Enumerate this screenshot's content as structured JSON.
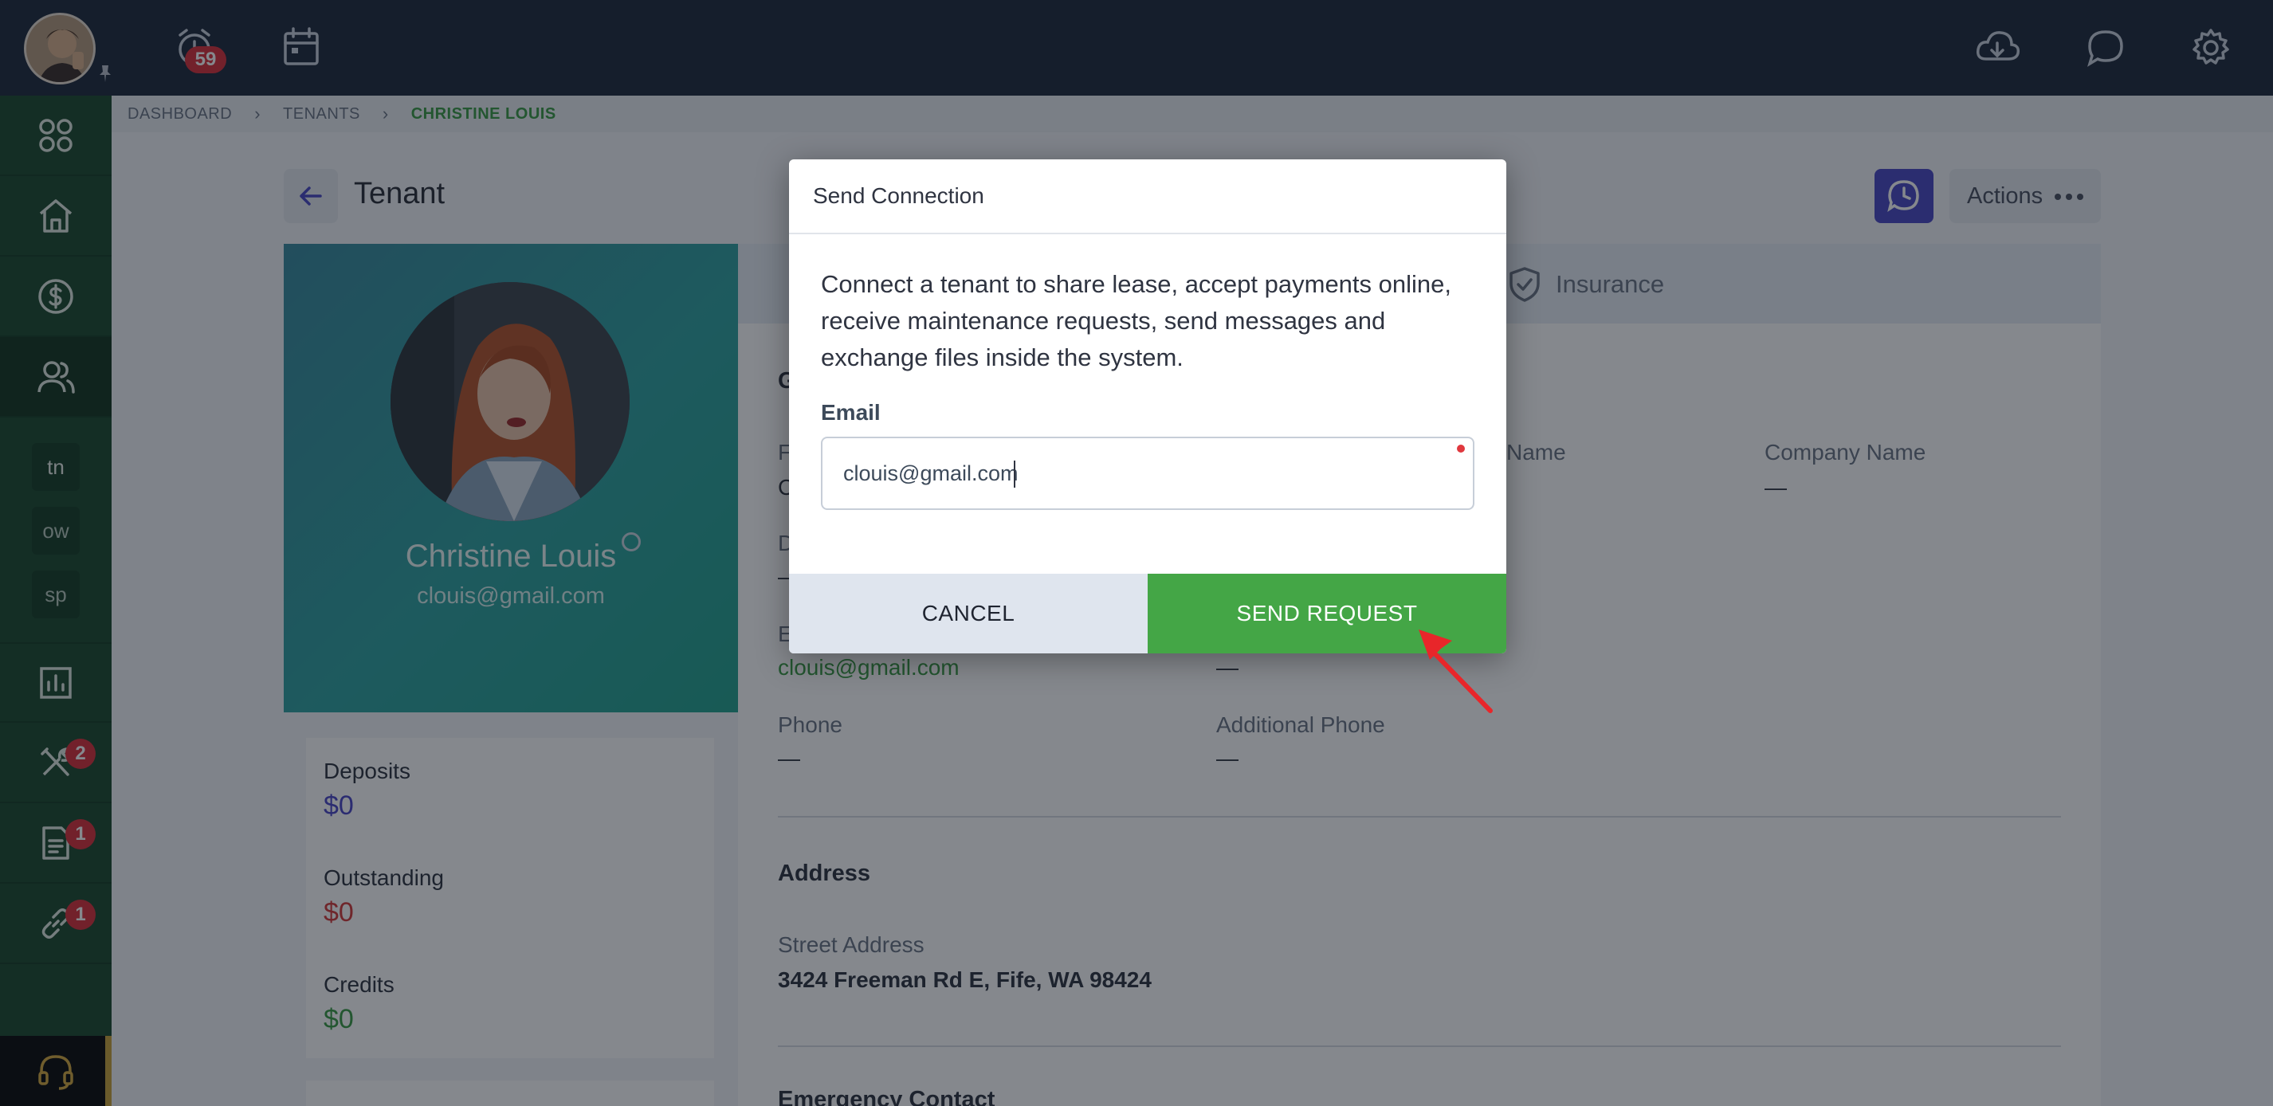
{
  "topbar": {
    "alarm_count": "59",
    "icons": [
      "alarm-clock-icon",
      "calendar-icon",
      "cloud-download-icon",
      "chat-bubble-icon",
      "gear-icon"
    ]
  },
  "sidebar": {
    "shortcuts": [
      "tn",
      "ow",
      "sp"
    ],
    "maintenance_badge": "2",
    "documents_badge": "1",
    "connections_badge": "1"
  },
  "breadcrumb": {
    "items": [
      "DASHBOARD",
      "TENANTS",
      "CHRISTINE LOUIS"
    ]
  },
  "page": {
    "title": "Tenant",
    "actions_label": "Actions"
  },
  "profile": {
    "name": "Christine Louis",
    "email": "clouis@gmail.com"
  },
  "balances": {
    "deposits_label": "Deposits",
    "deposits_value": "$0",
    "outstanding_label": "Outstanding",
    "outstanding_value": "$0",
    "credits_label": "Credits",
    "credits_value": "$0"
  },
  "details": {
    "insurance_tab": "Insurance",
    "partial_heading": "G",
    "partial_label_1": "F",
    "partial_value_1": "C",
    "partial_label_2": "D",
    "partial_value_2": "—",
    "partial_label_3": "E",
    "name_label_partial": "Name",
    "company_name_label": "Company Name",
    "company_name_value": "—",
    "email_value": "clouis@gmail.com",
    "email_side_value": "—",
    "phone_label": "Phone",
    "phone_value": "—",
    "additional_phone_label": "Additional Phone",
    "additional_phone_value": "—",
    "address_title": "Address",
    "street_address_label": "Street Address",
    "street_address_value": "3424 Freeman Rd E, Fife, WA 98424",
    "emergency_contact_title": "Emergency Contact"
  },
  "modal": {
    "title": "Send Connection",
    "description": "Connect a tenant to share lease, accept payments online, receive maintenance requests, send messages and exchange files inside the system.",
    "email_label": "Email",
    "email_value": "clouis@gmail.com",
    "cancel_label": "CANCEL",
    "send_label": "SEND REQUEST"
  },
  "colors": {
    "topbar": "#1e2a3d",
    "sidebar": "#1d4a2e",
    "send_button": "#44a646",
    "history_button": "#4a48c4"
  }
}
